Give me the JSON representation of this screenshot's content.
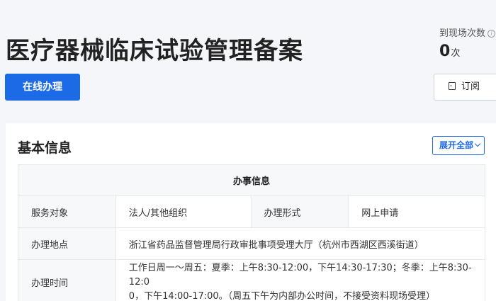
{
  "header": {
    "title": "医疗器械临床试验管理备案",
    "visits_label": "到现场次数",
    "visits_count": "0",
    "visits_unit": "次",
    "apply_label": "在线办理",
    "subscribe_label": "订阅"
  },
  "basic_info": {
    "title": "基本信息",
    "expand_label": "展开全部",
    "table_caption": "办事信息",
    "service_target_label": "服务对象",
    "service_target_value": "法人/其他组织",
    "handle_form_label": "办理形式",
    "handle_form_value": "网上申请",
    "location_label": "办理地点",
    "location_value": "浙江省药品监督管理局行政审批事项受理大厅（杭州市西湖区西溪街道）",
    "hours_label": "办理时间",
    "hours_line1": "工作日周一～周五：夏季：上午8:30-12:00，下午14:30-17:30；冬季：上午8:30-12:0",
    "hours_line2": "0，下午14:00-17:00。（周五下午为内部办公时间，不接受资料现场受理）"
  }
}
